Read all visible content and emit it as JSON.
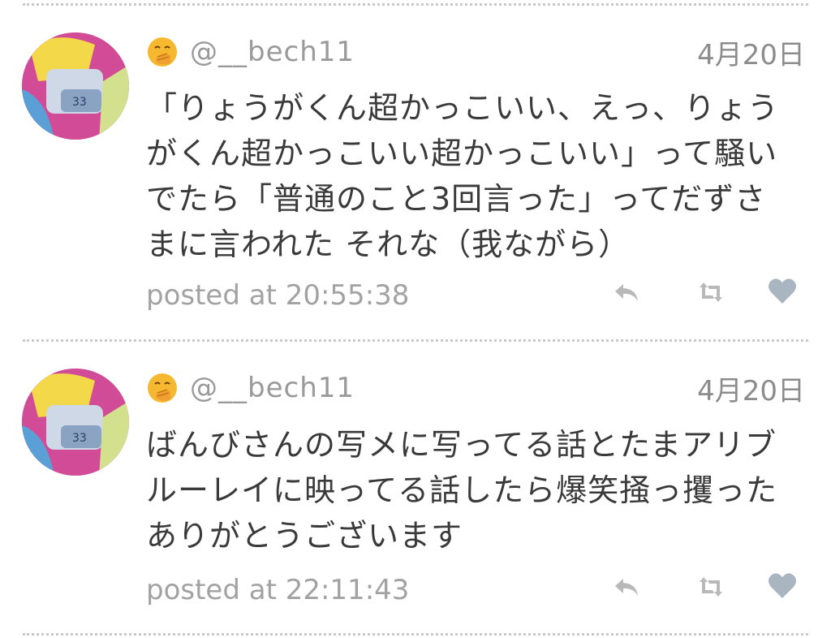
{
  "tweets": [
    {
      "username": "@__bech11",
      "date": "4月20日",
      "text": "「りょうがくん超かっこいい、えっ、りょう\nがくん超かっこいい超かっこいい」って騒い\nでたら「普通のこと3回言った」ってだずさ\nまに言われた それな（我ながら）",
      "posted": "posted at 20:55:38",
      "emoji_icon": "face-with-hand-over-mouth-icon",
      "actions": [
        "reply-icon",
        "retweet-icon",
        "like-heart-icon"
      ]
    },
    {
      "username": "@__bech11",
      "date": "4月20日",
      "text": "ばんびさんの写メに写ってる話とたまアリブ\nルーレイに映ってる話したら爆笑掻っ攫った\nありがとうございます",
      "posted": "posted at 22:11:43",
      "emoji_icon": "face-with-hand-over-mouth-icon",
      "actions": [
        "reply-icon",
        "retweet-icon",
        "like-heart-icon"
      ]
    }
  ],
  "colors": {
    "text": "#3a3a3a",
    "meta": "#9a9a9a",
    "icon": "#b9b9b9",
    "heart": "#a9b6c2",
    "divider": "#c9c9c9",
    "emoji": "#f5b82e"
  }
}
